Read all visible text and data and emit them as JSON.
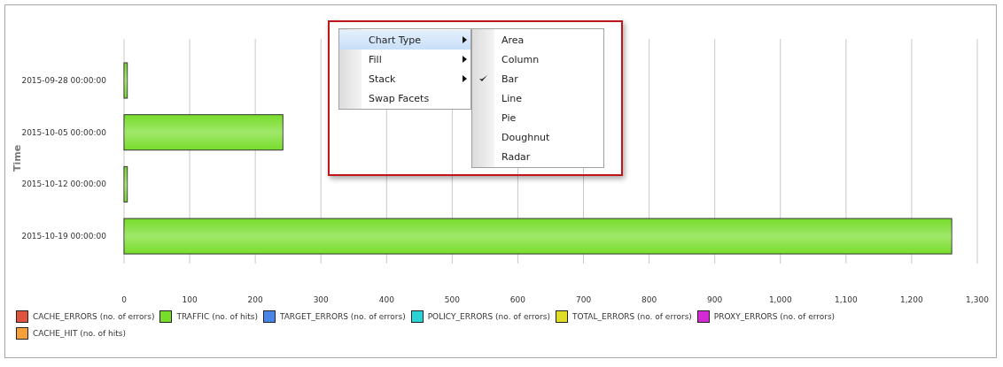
{
  "chart": {
    "chart_data": {
      "type": "bar",
      "orientation": "horizontal",
      "grid": true,
      "ylabel": "Time",
      "categories": [
        "2015-09-28 00:00:00",
        "2015-10-05 00:00:00",
        "2015-10-12 00:00:00",
        "2015-10-19 00:00:00"
      ],
      "series": [
        {
          "name": "CACHE_ERRORS (no. of errors)",
          "color": "#e0533f",
          "values": [
            null,
            null,
            null,
            null
          ]
        },
        {
          "name": "TRAFFIC (no. of hits)",
          "color": "#77dd2a",
          "values": [
            5,
            242,
            5,
            1261
          ]
        },
        {
          "name": "TARGET_ERRORS (no. of errors)",
          "color": "#4a86e8",
          "values": [
            null,
            null,
            null,
            null
          ]
        },
        {
          "name": "POLICY_ERRORS (no. of errors)",
          "color": "#2ad4d4",
          "values": [
            null,
            null,
            null,
            null
          ]
        },
        {
          "name": "TOTAL_ERRORS (no. of errors)",
          "color": "#e0dc2a",
          "values": [
            null,
            null,
            null,
            null
          ]
        },
        {
          "name": "PROXY_ERRORS (no. of errors)",
          "color": "#d42ad4",
          "values": [
            null,
            null,
            null,
            null
          ]
        },
        {
          "name": "CACHE_HIT (no. of hits)",
          "color": "#f7a03a",
          "values": [
            null,
            null,
            null,
            null
          ]
        }
      ],
      "xlim": [
        0,
        1300
      ],
      "xticks": [
        0,
        100,
        200,
        300,
        400,
        500,
        600,
        700,
        800,
        900,
        {
          "value": 1000,
          "label": "1,000"
        },
        {
          "value": 1100,
          "label": "1,100"
        },
        {
          "value": 1200,
          "label": "1,200"
        },
        {
          "value": 1300,
          "label": "1,300"
        }
      ]
    }
  },
  "context_menu": {
    "items": [
      {
        "label": "Chart Type",
        "submenu": true,
        "selected": true
      },
      {
        "label": "Fill",
        "submenu": true,
        "selected": false
      },
      {
        "label": "Stack",
        "submenu": true,
        "selected": false
      },
      {
        "label": "Swap Facets",
        "submenu": false,
        "selected": false
      }
    ],
    "submenu": [
      {
        "label": "Area",
        "checked": false
      },
      {
        "label": "Column",
        "checked": false
      },
      {
        "label": "Bar",
        "checked": true
      },
      {
        "label": "Line",
        "checked": false
      },
      {
        "label": "Pie",
        "checked": false
      },
      {
        "label": "Doughnut",
        "checked": false
      },
      {
        "label": "Radar",
        "checked": false
      }
    ]
  }
}
